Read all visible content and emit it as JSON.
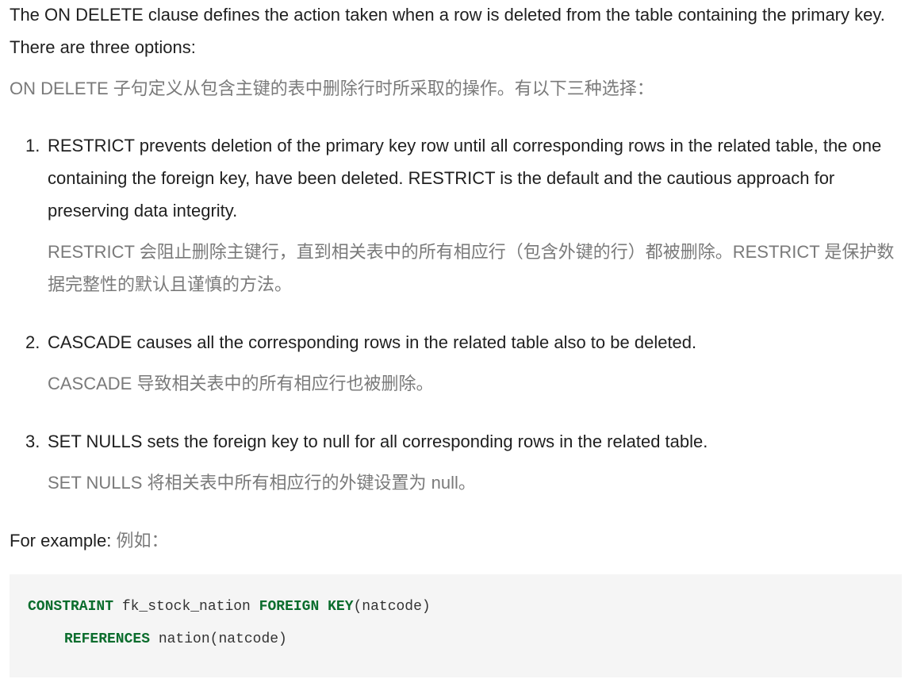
{
  "intro": {
    "en": "The ON DELETE clause defines the action taken when a row is deleted from the table containing the primary key. There are three options:",
    "cn": "ON DELETE 子句定义从包含主键的表中删除行时所采取的操作。有以下三种选择："
  },
  "options": [
    {
      "number": "1.",
      "en": "RESTRICT prevents deletion of the primary key row until all corresponding rows in the related table, the one containing the foreign key, have been deleted. RESTRICT is the default and the cautious approach for preserving data integrity.",
      "cn": "RESTRICT 会阻止删除主键行，直到相关表中的所有相应行（包含外键的行）都被删除。RESTRICT 是保护数据完整性的默认且谨慎的方法。"
    },
    {
      "number": "2.",
      "en": "CASCADE causes all the corresponding rows in the related table also to be deleted.",
      "cn": "CASCADE 导致相关表中的所有相应行也被删除。"
    },
    {
      "number": "3.",
      "en": "SET NULLS sets the foreign key to null for all corresponding rows in the related table.",
      "cn": "SET NULLS 将相关表中所有相应行的外键设置为 null。"
    }
  ],
  "example": {
    "en": "For example:",
    "cn": "例如："
  },
  "code": {
    "line1": {
      "kw1": "CONSTRAINT",
      "text1": " fk_stock_nation ",
      "kw2": "FOREIGN KEY",
      "text2": "(natcode)"
    },
    "line2": {
      "kw1": "REFERENCES",
      "text1": " nation(natcode)"
    }
  },
  "colors": {
    "text": "#1f1f1f",
    "translation": "#7a7a7a",
    "code_background": "#f5f5f5",
    "code_keyword": "#0b6d2d"
  }
}
